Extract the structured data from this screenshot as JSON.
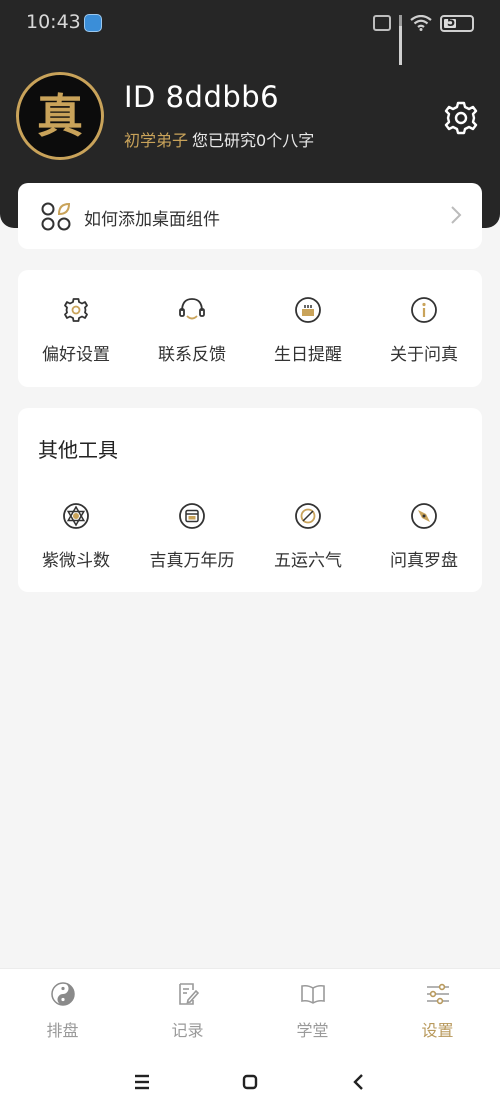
{
  "status_bar": {
    "time": "10:43",
    "battery": "5"
  },
  "profile": {
    "id_text": "ID 8ddbb6",
    "level": "初学弟子",
    "research_text": "您已研究0个八字",
    "avatar_char": "真"
  },
  "widget_card": {
    "label": "如何添加桌面组件"
  },
  "shortcuts": [
    {
      "label": "偏好设置",
      "icon": "gear-icon"
    },
    {
      "label": "联系反馈",
      "icon": "headset-icon"
    },
    {
      "label": "生日提醒",
      "icon": "birthday-cake-icon"
    },
    {
      "label": "关于问真",
      "icon": "info-icon"
    }
  ],
  "tools": {
    "title": "其他工具",
    "items": [
      {
        "label": "紫微斗数",
        "icon": "star-of-david-icon"
      },
      {
        "label": "吉真万年历",
        "icon": "calendar-icon"
      },
      {
        "label": "五运六气",
        "icon": "compass-dial-icon"
      },
      {
        "label": "问真罗盘",
        "icon": "compass-needle-icon"
      }
    ]
  },
  "tabbar": {
    "items": [
      {
        "label": "排盘",
        "icon": "yin-yang-icon",
        "active": false
      },
      {
        "label": "记录",
        "icon": "notes-edit-icon",
        "active": false
      },
      {
        "label": "学堂",
        "icon": "open-book-icon",
        "active": false
      },
      {
        "label": "设置",
        "icon": "sliders-icon",
        "active": true
      }
    ]
  },
  "colors": {
    "header_bg": "#262626",
    "accent_gold": "#c9a35a",
    "page_bg": "#f5f5f5"
  }
}
